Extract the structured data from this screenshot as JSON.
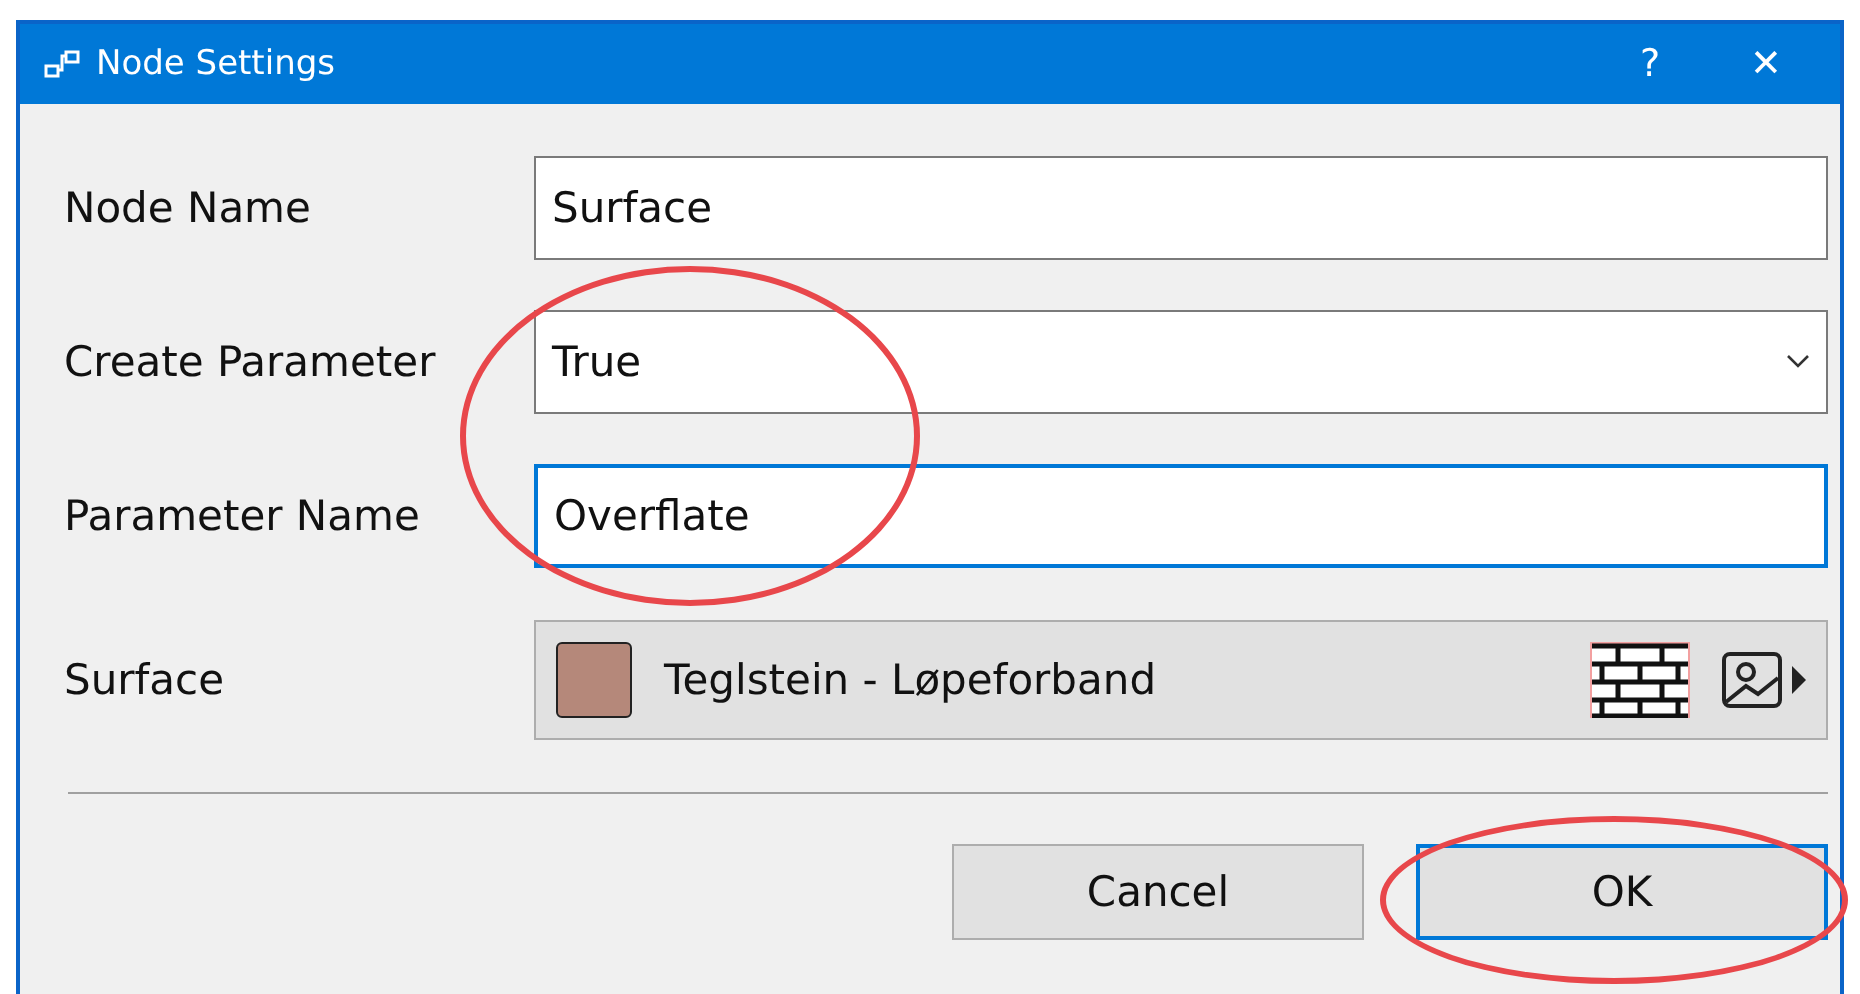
{
  "window": {
    "title": "Node Settings",
    "help": "?",
    "close": "✕"
  },
  "fields": [
    {
      "kind": "text",
      "label": "Node Name",
      "value": "Surface",
      "focused": false
    },
    {
      "kind": "select",
      "label": "Create Parameter",
      "value": "True",
      "focused": false
    },
    {
      "kind": "text",
      "label": "Parameter Name",
      "value": "Overflate",
      "focused": true
    },
    {
      "kind": "material",
      "label": "Surface",
      "value": "Teglstein - Løpeforband",
      "color": "#b5887a",
      "focused": false
    }
  ],
  "buttons": [
    {
      "label": "Cancel",
      "default": false
    },
    {
      "label": "OK",
      "default": true
    }
  ],
  "annotations": [
    {
      "kind": "ellipse"
    },
    {
      "kind": "ellipse"
    }
  ]
}
